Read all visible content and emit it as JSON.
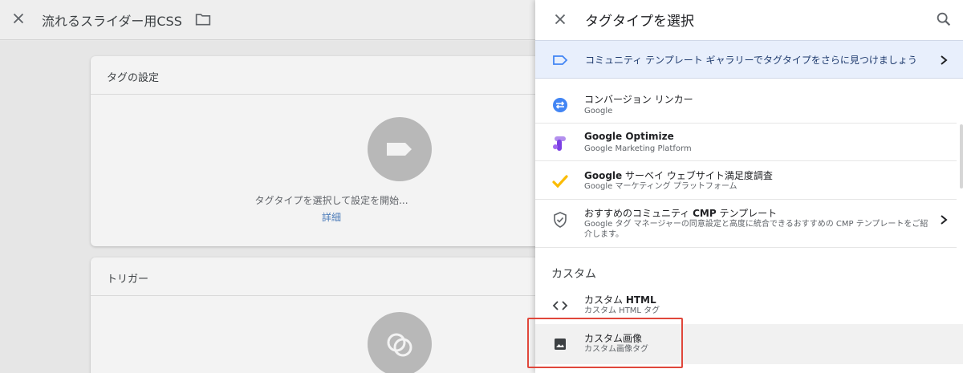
{
  "background": {
    "workspace_title": "流れるスライダー用CSS",
    "tag_card": {
      "title": "タグの設定",
      "hint": "タグタイプを選択して設定を開始...",
      "link": "詳細"
    },
    "trigger_card": {
      "title": "トリガー"
    }
  },
  "panel": {
    "title": "タグタイプを選択",
    "banner_text": "コミュニティ テンプレート ギャラリーでタグタイプをさらに見つけましょう",
    "items": [
      {
        "name": "コンバージョン リンカー",
        "sub": "Google",
        "icon": "conversion-linker-icon"
      },
      {
        "name_bold": "Google Optimize",
        "sub": "Google Marketing Platform",
        "icon": "optimize-icon"
      },
      {
        "name_bold": "Google",
        "name_rest": " サーベイ ウェブサイト満足度調査",
        "sub": "Google マーケティング プラットフォーム",
        "icon": "surveys-icon"
      },
      {
        "name_pre": "おすすめのコミュニティ ",
        "name_bold": "CMP",
        "name_rest": " テンプレート",
        "sub": "Google タグ マネージャーの同意設定と高度に統合できるおすすめの CMP テンプレートをご紹介します。",
        "icon": "shield-check-icon"
      }
    ],
    "section_label": "カスタム",
    "custom_items": [
      {
        "name_pre": "カスタム ",
        "name_bold": "HTML",
        "sub": "カスタム HTML タグ",
        "icon": "code-icon"
      },
      {
        "name": "カスタム画像",
        "sub": "カスタム画像タグ",
        "icon": "image-icon"
      }
    ]
  },
  "colors": {
    "accent_blue": "#4285f4",
    "highlight_red": "#e0473b",
    "banner_bg": "#e8effc"
  }
}
